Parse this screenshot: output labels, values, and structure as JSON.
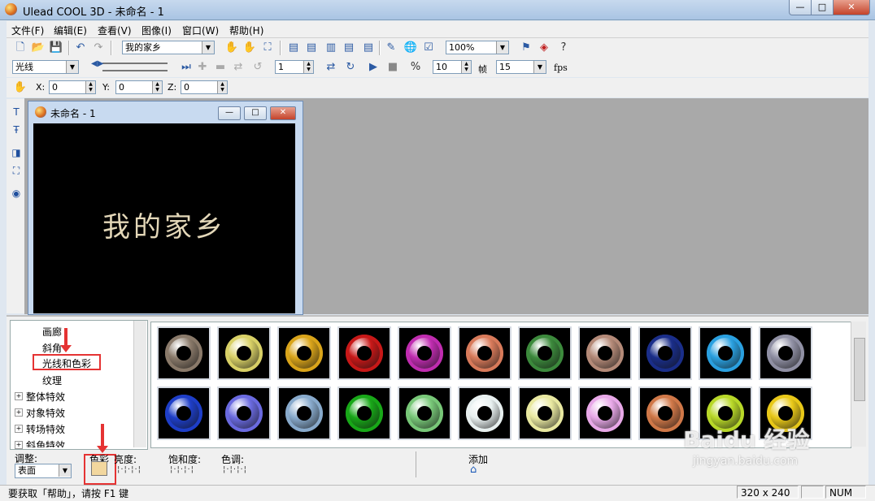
{
  "window": {
    "title": "Ulead COOL 3D - 未命名 - 1",
    "minimize": "—",
    "maximize": "□",
    "close": "✕"
  },
  "menu": [
    "文件(F)",
    "编辑(E)",
    "查看(V)",
    "图像(I)",
    "窗口(W)",
    "帮助(H)"
  ],
  "toolbar1": {
    "text_combo": "我的家乡",
    "zoom_combo": "100%"
  },
  "toolbar2": {
    "mode_combo": "光线",
    "frame_value": "1",
    "frames_total": "10",
    "frame_label": "帧",
    "fps_value": "15",
    "fps_label": "fps"
  },
  "toolbar3": {
    "x_label": "X:",
    "x_value": "0",
    "y_label": "Y:",
    "y_value": "0",
    "z_label": "Z:",
    "z_value": "0"
  },
  "document": {
    "title": "未命名 - 1",
    "canvas_text": "我的家乡"
  },
  "tree": {
    "items": [
      {
        "label": "画廊",
        "expandable": false
      },
      {
        "label": "斜角",
        "expandable": false
      },
      {
        "label": "光线和色彩",
        "expandable": false,
        "highlighted": true
      },
      {
        "label": "纹理",
        "expandable": false
      },
      {
        "label": "整体特效",
        "expandable": true
      },
      {
        "label": "对象特效",
        "expandable": true
      },
      {
        "label": "转场特效",
        "expandable": true
      },
      {
        "label": "斜角特效",
        "expandable": true
      }
    ]
  },
  "gallery": {
    "row1_colors": [
      "#8a7a6a",
      "#d8d066",
      "#d9a41a",
      "#c81818",
      "#c02cb0",
      "#d87a5a",
      "#3c8a3c",
      "#b48a78",
      "#1a2e8a",
      "#2aa0e0",
      "#9090a4"
    ],
    "row2_colors": [
      "#1e3ec8",
      "#6a6ae0",
      "#88aacc",
      "#18a818",
      "#78c878",
      "#e8f0f0",
      "#e8e8a0",
      "#e8a8e8",
      "#d07848",
      "#b8d828",
      "#e8c818"
    ]
  },
  "settings": {
    "adjust_label": "调整:",
    "surface_combo": "表面",
    "color_label": "色彩",
    "brightness_label": "亮度:",
    "saturation_label": "饱和度:",
    "hue_label": "色调:",
    "add_label": "添加"
  },
  "status": {
    "help_text": "要获取「帮助」，请按 F1 键",
    "size": "320 x 240",
    "num": "NUM"
  },
  "watermark": {
    "brand": "Baidu 经验",
    "url": "jingyan.baidu.com"
  },
  "colors": {
    "highlight_red": "#e53333",
    "color_swatch": "#f2d79e"
  }
}
